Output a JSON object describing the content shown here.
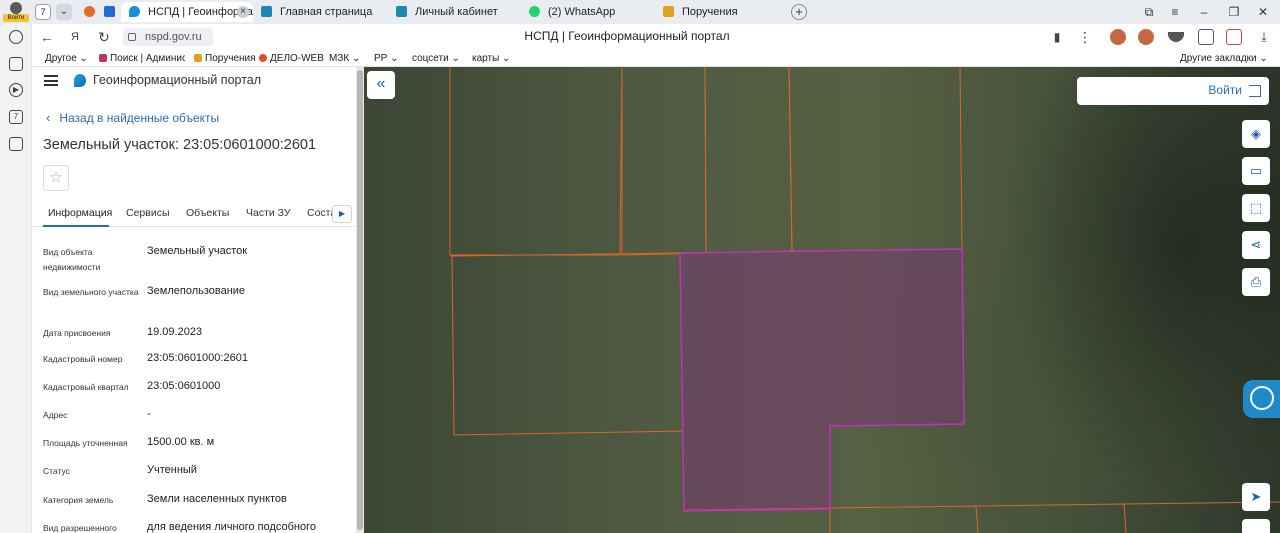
{
  "browser": {
    "profile_label": "Войти",
    "tab_count": "7",
    "tabs": [
      {
        "label": "НСПД | Геоинформаци",
        "color": "#1a8fd6"
      },
      {
        "label": "Главная страница",
        "color": "#1e88b5"
      },
      {
        "label": "Личный кабинет",
        "color": "#1e88b5"
      },
      {
        "label": "(2) WhatsApp",
        "color": "#25d366"
      },
      {
        "label": "Поручения",
        "color": "#e0a023"
      }
    ],
    "url": "nspd.gov.ru",
    "page_title": "НСПД | Геоинформационный портал"
  },
  "bookmarks": {
    "items": [
      {
        "label": "Другое",
        "dropdown": true
      },
      {
        "label": "Поиск | Админис",
        "dropdown": false
      },
      {
        "label": "Поручения",
        "dropdown": false
      },
      {
        "label": "ДЕЛО-WEB",
        "dropdown": false
      },
      {
        "label": "МЗК",
        "dropdown": true
      },
      {
        "label": "РР",
        "dropdown": true
      },
      {
        "label": "соцсети",
        "dropdown": true
      },
      {
        "label": "карты",
        "dropdown": true
      }
    ],
    "other_label": "Другие закладки"
  },
  "panel": {
    "brand": "Геоинформационный портал",
    "back_link": "Назад в найденные объекты",
    "title": "Земельный участок: 23:05:0601000:2601",
    "tabs": [
      "Информация",
      "Сервисы",
      "Объекты",
      "Части ЗУ",
      "Соста"
    ],
    "fields": [
      {
        "label": "Вид объекта недвижимости",
        "value": "Земельный участок"
      },
      {
        "label": "Вид земельного участка",
        "value": "Землепользование"
      },
      {
        "label": "Дата присвоения",
        "value": "19.09.2023"
      },
      {
        "label": "Кадастровый номер",
        "value": "23:05:0601000:2601"
      },
      {
        "label": "Кадастровый квартал",
        "value": "23:05:0601000"
      },
      {
        "label": "Адрес",
        "value": "-"
      },
      {
        "label": "Площадь уточненная",
        "value": "1500.00 кв. м"
      },
      {
        "label": "Статус",
        "value": "Учтенный"
      },
      {
        "label": "Категория земель",
        "value": "Земли населенных пунктов"
      },
      {
        "label": "Вид разрешенного",
        "value": "для ведения личного подсобного"
      }
    ]
  },
  "map": {
    "login_label": "Войти",
    "parcel_border_color": "#d9662e",
    "selected_parcel_color": "#c030c0"
  }
}
